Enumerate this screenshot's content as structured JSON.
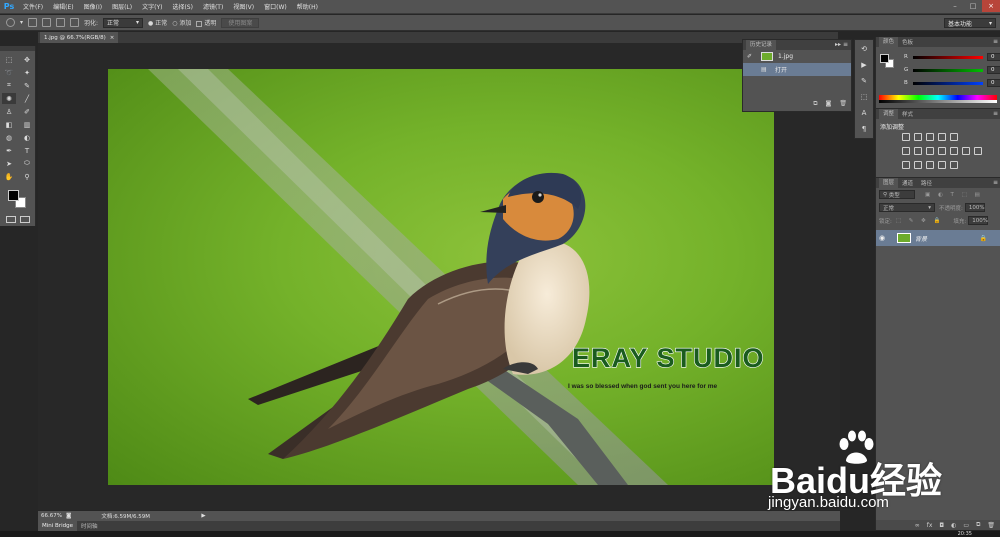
{
  "app": {
    "logo": "Ps"
  },
  "menu": [
    "文件(F)",
    "编辑(E)",
    "图像(I)",
    "图层(L)",
    "文字(Y)",
    "选择(S)",
    "滤镜(T)",
    "视图(V)",
    "窗口(W)",
    "帮助(H)"
  ],
  "options": {
    "feather_label": "羽化:",
    "mode_value": "正常",
    "opt_normal": "正常",
    "opt_add": "添加",
    "opt_transparent": "透明",
    "use_pattern": "使用图案",
    "workspace": "基本功能"
  },
  "document": {
    "tab_title": "1.jpg @ 66.7%(RGB/8)",
    "tab_close": "×",
    "brand_title": "ERAY STUDIO",
    "brand_tagline": "I was so blessed when god sent you here for me"
  },
  "history": {
    "tab_label": "历史记录",
    "items": [
      {
        "label": "1.jpg"
      },
      {
        "label": "打开"
      }
    ]
  },
  "color_panel": {
    "tab_color": "颜色",
    "tab_swatches": "色板",
    "channels": [
      {
        "name": "R",
        "value": "0",
        "color": "#ff0000"
      },
      {
        "name": "G",
        "value": "0",
        "color": "#00c000"
      },
      {
        "name": "B",
        "value": "0",
        "color": "#0040ff"
      }
    ]
  },
  "adjustments": {
    "tab_adjust": "调整",
    "tab_styles": "样式",
    "add_label": "添加调整"
  },
  "layers": {
    "tab_layers": "图层",
    "tab_channels": "通道",
    "tab_paths": "路径",
    "kind_label": "类型",
    "blend_mode": "正常",
    "opacity_label": "不透明度:",
    "opacity_value": "100%",
    "lock_label": "锁定:",
    "fill_label": "填充:",
    "fill_value": "100%",
    "layer_name": "背景"
  },
  "status": {
    "zoom": "66.67%",
    "doc_info": "文档:6.59M/6.59M",
    "arrow": "▶"
  },
  "bottom_tabs": [
    "Mini Bridge",
    "时间轴"
  ],
  "taskbar": {
    "clock": "20:35"
  },
  "watermark": {
    "text": "Baidu经验",
    "url": "jingyan.baidu.com"
  },
  "colors": {
    "accent": "#31a8ff",
    "selection": "#6a7c94",
    "brand_green": "#1a5c1e"
  }
}
